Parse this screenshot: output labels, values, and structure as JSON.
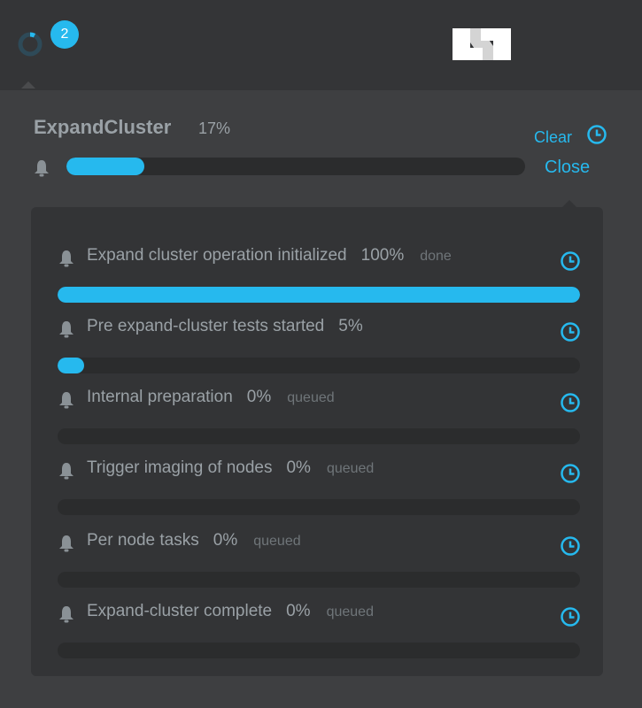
{
  "header": {
    "notification_count": "2",
    "logo": "N"
  },
  "operation": {
    "title": "ExpandCluster",
    "percent_label": "17%",
    "progress": 0.17,
    "clear_label": "Clear",
    "close_label": "Close"
  },
  "tasks": [
    {
      "name": "Expand cluster operation initialized",
      "percent_label": "100%",
      "progress": 1.0,
      "status": "done"
    },
    {
      "name": "Pre expand-cluster tests started",
      "percent_label": "5%",
      "progress": 0.05,
      "status": ""
    },
    {
      "name": "Internal preparation",
      "percent_label": "0%",
      "progress": 0,
      "status": "queued"
    },
    {
      "name": "Trigger imaging of nodes",
      "percent_label": "0%",
      "progress": 0,
      "status": "queued"
    },
    {
      "name": "Per node tasks",
      "percent_label": "0%",
      "progress": 0,
      "status": "queued"
    },
    {
      "name": "Expand-cluster complete",
      "percent_label": "0%",
      "progress": 0,
      "status": "queued"
    }
  ],
  "colors": {
    "accent": "#26b9ee",
    "text_muted": "#9aa1a6",
    "status_text": "#6f7579",
    "track": "#2b2c2d"
  }
}
